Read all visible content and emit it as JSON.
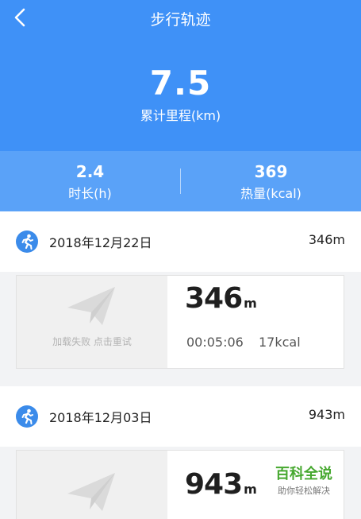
{
  "header": {
    "title": "步行轨迹",
    "total_value": "7.5",
    "total_label": "累计里程(km)"
  },
  "stats": [
    {
      "value": "2.4",
      "label": "时长(h)"
    },
    {
      "value": "369",
      "label": "热量(kcal)"
    }
  ],
  "records": [
    {
      "date": "2018年12月22日",
      "distance": "346m",
      "big_value": "346",
      "big_unit": "m",
      "map_text": "加载失败 点击重试",
      "duration": "00:05:06",
      "kcal": "17kcal"
    },
    {
      "date": "2018年12月03日",
      "distance": "943m",
      "big_value": "943",
      "big_unit": "m"
    }
  ],
  "watermark": {
    "title": "百科全说",
    "subtitle": "助你轻松解决"
  },
  "colors": {
    "header_blue": "#3f91f7",
    "stats_blue": "#5aa2f8",
    "runner_blue": "#3b8bea",
    "watermark_green": "#46a82f"
  },
  "icons": [
    "back-arrow-icon",
    "runner-icon",
    "paper-plane-icon"
  ]
}
